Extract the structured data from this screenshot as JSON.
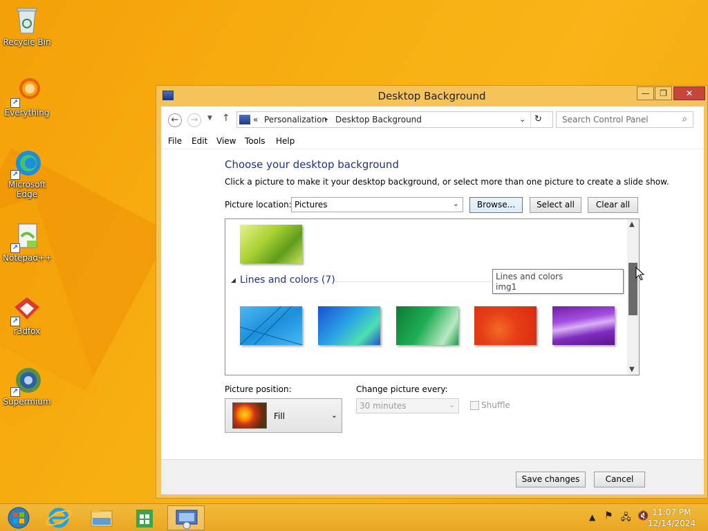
{
  "desktop": {
    "icons": [
      {
        "label": "Recycle Bin"
      },
      {
        "label": "Everything"
      },
      {
        "label": "Microsoft Edge"
      },
      {
        "label": "Notepad++"
      },
      {
        "label": "r3dfox"
      },
      {
        "label": "Supermium"
      }
    ]
  },
  "window": {
    "title": "Desktop Background",
    "address": {
      "prefix": "«",
      "crumb1": "Personalization",
      "separator": "▸",
      "crumb2": "Desktop Background"
    },
    "search_placeholder": "Search Control Panel",
    "menu": [
      "File",
      "Edit",
      "View",
      "Tools",
      "Help"
    ],
    "heading": "Choose your desktop background",
    "subtext": "Click a picture to make it your desktop background, or select more than one picture to create a slide show.",
    "picture_location": {
      "label": "Picture location:",
      "value": "Pictures"
    },
    "buttons": {
      "browse": "Browse...",
      "select_all": "Select all",
      "clear_all": "Clear all",
      "save": "Save changes",
      "cancel": "Cancel"
    },
    "group": {
      "title": "Lines and colors (7)"
    },
    "tooltip": {
      "line1": "Lines and colors",
      "line2": "img1"
    },
    "picture_position": {
      "label": "Picture position:",
      "value": "Fill"
    },
    "change_picture": {
      "label": "Change picture every:",
      "value": "30 minutes"
    },
    "shuffle_label": "Shuffle"
  },
  "taskbar": {
    "time": "11:07 PM",
    "date": "12/14/2024"
  },
  "colors": {
    "accent": "#1e3287",
    "window_frame": "#f5c35a",
    "desktop": "#f7b012"
  }
}
